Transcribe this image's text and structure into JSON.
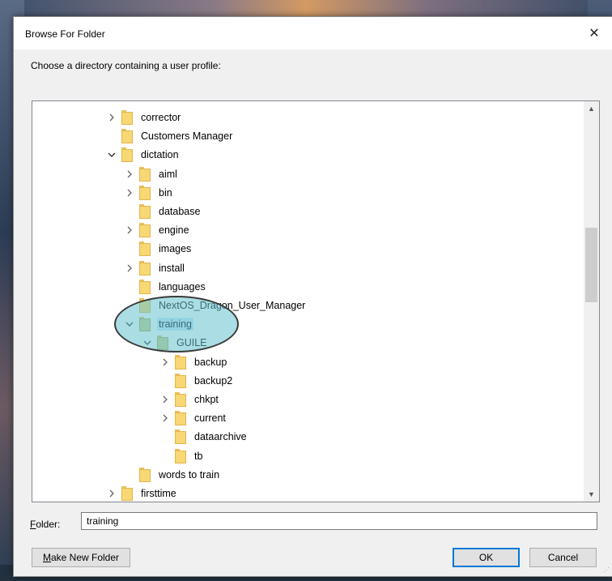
{
  "window": {
    "title": "Browse For Folder",
    "close_glyph": "✕"
  },
  "prompt": "Choose a directory containing a user profile:",
  "tree": {
    "items": [
      {
        "label": "corrector",
        "depth": 0,
        "expander": "collapsed"
      },
      {
        "label": "Customers Manager",
        "depth": 0,
        "expander": "none"
      },
      {
        "label": "dictation",
        "depth": 0,
        "expander": "expanded"
      },
      {
        "label": "aiml",
        "depth": 1,
        "expander": "collapsed"
      },
      {
        "label": "bin",
        "depth": 1,
        "expander": "collapsed"
      },
      {
        "label": "database",
        "depth": 1,
        "expander": "none"
      },
      {
        "label": "engine",
        "depth": 1,
        "expander": "collapsed"
      },
      {
        "label": "images",
        "depth": 1,
        "expander": "none"
      },
      {
        "label": "install",
        "depth": 1,
        "expander": "collapsed"
      },
      {
        "label": "languages",
        "depth": 1,
        "expander": "none"
      },
      {
        "label": "NextOS_Dragon_User_Manager",
        "depth": 1,
        "expander": "none"
      },
      {
        "label": "training",
        "depth": 1,
        "expander": "expanded",
        "selected": true
      },
      {
        "label": "GUILE",
        "depth": 2,
        "expander": "expanded"
      },
      {
        "label": "backup",
        "depth": 3,
        "expander": "collapsed"
      },
      {
        "label": "backup2",
        "depth": 3,
        "expander": "none"
      },
      {
        "label": "chkpt",
        "depth": 3,
        "expander": "collapsed"
      },
      {
        "label": "current",
        "depth": 3,
        "expander": "collapsed"
      },
      {
        "label": "dataarchive",
        "depth": 3,
        "expander": "none"
      },
      {
        "label": "tb",
        "depth": 3,
        "expander": "none"
      },
      {
        "label": "words to train",
        "depth": 1,
        "expander": "none"
      },
      {
        "label": "firsttime",
        "depth": 0,
        "expander": "collapsed"
      }
    ]
  },
  "folder_field": {
    "label_prefix": "F",
    "label_rest": "older:",
    "value": "training"
  },
  "buttons": {
    "make_new_folder_u": "M",
    "make_new_folder_rest": "ake New Folder",
    "ok": "OK",
    "cancel": "Cancel"
  },
  "colors": {
    "selection": "#cce8ff",
    "highlight_ellipse": "#64c3cd",
    "folder": "#f8d775",
    "default_button_border": "#0078d7"
  }
}
